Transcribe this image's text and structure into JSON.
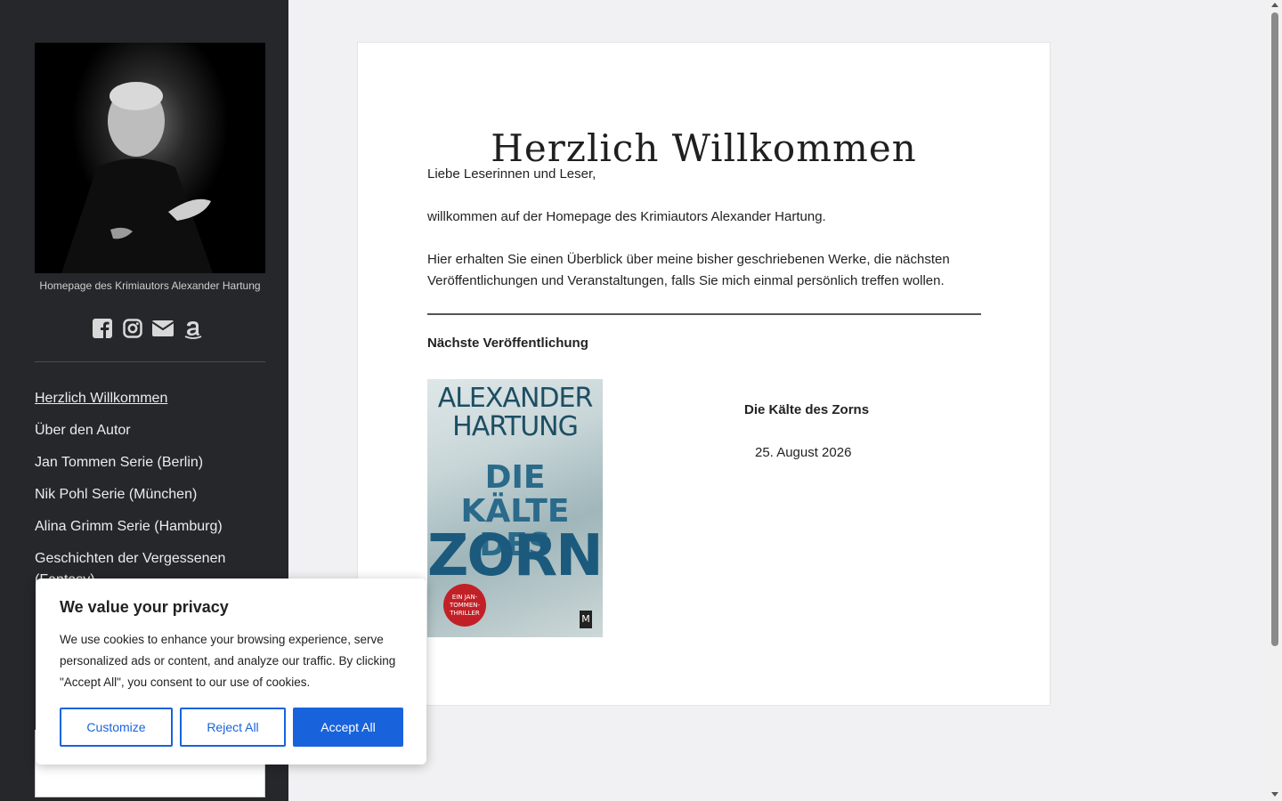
{
  "sidebar": {
    "tagline": "Homepage des Krimiautors Alexander Hartung",
    "social_icons": [
      "facebook-icon",
      "instagram-icon",
      "email-icon",
      "amazon-icon"
    ],
    "nav": [
      {
        "label": "Herzlich Willkommen",
        "active": true
      },
      {
        "label": "Über den Autor"
      },
      {
        "label": "Jan Tommen Serie (Berlin)"
      },
      {
        "label": "Nik Pohl Serie (München)"
      },
      {
        "label": "Alina Grimm Serie (Hamburg)"
      },
      {
        "label": "Geschichten der Vergessenen (Fantasy)"
      }
    ]
  },
  "main": {
    "title": "Herzlich Willkommen",
    "greeting": "Liebe Leserinnen und Leser,",
    "welcome": "willkommen auf der Homepage des Krimiautors Alexander Hartung.",
    "intro": "Hier erhalten Sie einen Überblick über meine bisher geschriebenen Werke, die nächsten Veröffentlichungen und Veranstaltungen, falls Sie mich einmal persönlich treffen wollen.",
    "next_heading": "Nächste Veröffentlichung",
    "book": {
      "cover_author": "ALEXANDER HARTUNG",
      "cover_title_top": "DIE KÄLTE DES",
      "cover_title_main": "ZORNS",
      "cover_seal": "EIN JAN-TOMMEN-THRILLER",
      "cover_publisher": "M",
      "title": "Die Kälte des Zorns",
      "date": "25. August 2026"
    }
  },
  "cookie": {
    "title": "We value your privacy",
    "text": "We use cookies to enhance your browsing experience, serve personalized ads or content, and analyze our traffic. By clicking \"Accept All\", you consent to our use of cookies.",
    "customize": "Customize",
    "reject": "Reject All",
    "accept": "Accept All"
  },
  "colors": {
    "sidebar_bg": "#25272b",
    "accent": "#1863dc"
  }
}
